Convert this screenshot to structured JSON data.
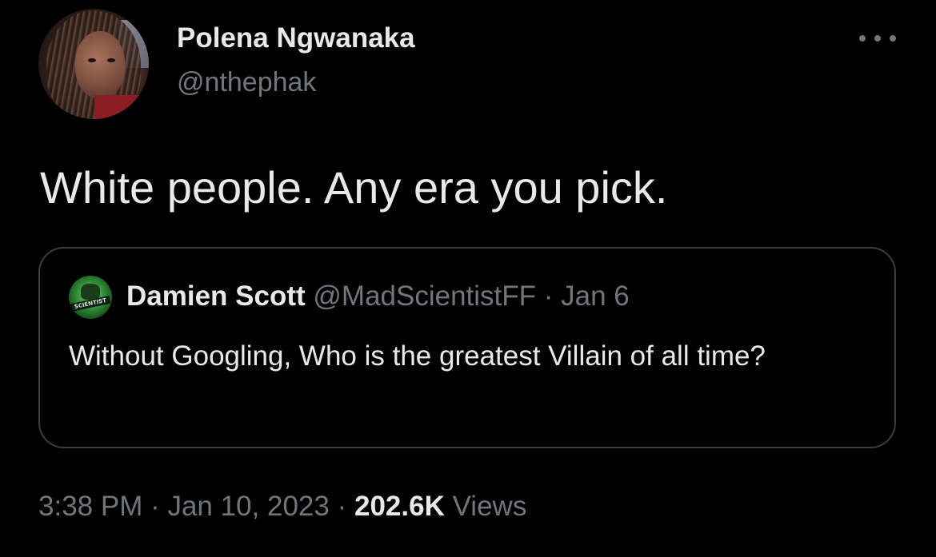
{
  "author": {
    "display_name": "Polena Ngwanaka",
    "handle": "@nthephak"
  },
  "tweet": {
    "text": "White people. Any era you pick."
  },
  "quoted_tweet": {
    "display_name": "Damien Scott",
    "handle": "@MadScientistFF",
    "separator": " · ",
    "date": "Jan 6",
    "text": "Without Googling, Who is the greatest Villain of all time?",
    "avatar_label": "SCIENTIST"
  },
  "footer": {
    "time": "3:38 PM",
    "separator": " · ",
    "date": "Jan 10, 2023",
    "views_count": "202.6K",
    "views_label": "Views"
  },
  "icons": {
    "more": "more-options-icon"
  },
  "colors": {
    "background": "#000000",
    "primary_text": "#e7e9ea",
    "secondary_text": "#71767b",
    "border": "#3a3d41"
  }
}
